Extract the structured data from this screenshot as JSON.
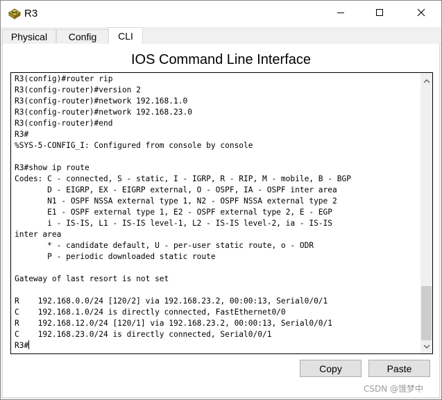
{
  "window": {
    "title": "R3"
  },
  "tabs": [
    {
      "label": "Physical",
      "active": false
    },
    {
      "label": "Config",
      "active": false
    },
    {
      "label": "CLI",
      "active": true
    }
  ],
  "cli": {
    "heading": "IOS Command Line Interface",
    "lines": [
      "R3(config)#router rip",
      "R3(config-router)#version 2",
      "R3(config-router)#network 192.168.1.0",
      "R3(config-router)#network 192.168.23.0",
      "R3(config-router)#end",
      "R3#",
      "%SYS-5-CONFIG_I: Configured from console by console",
      "",
      "R3#show ip route",
      "Codes: C - connected, S - static, I - IGRP, R - RIP, M - mobile, B - BGP",
      "       D - EIGRP, EX - EIGRP external, O - OSPF, IA - OSPF inter area",
      "       N1 - OSPF NSSA external type 1, N2 - OSPF NSSA external type 2",
      "       E1 - OSPF external type 1, E2 - OSPF external type 2, E - EGP",
      "       i - IS-IS, L1 - IS-IS level-1, L2 - IS-IS level-2, ia - IS-IS",
      "inter area",
      "       * - candidate default, U - per-user static route, o - ODR",
      "       P - periodic downloaded static route",
      "",
      "Gateway of last resort is not set",
      "",
      "R    192.168.0.0/24 [120/2] via 192.168.23.2, 00:00:13, Serial0/0/1",
      "C    192.168.1.0/24 is directly connected, FastEthernet0/0",
      "R    192.168.12.0/24 [120/1] via 192.168.23.2, 00:00:13, Serial0/0/1",
      "C    192.168.23.0/24 is directly connected, Serial0/0/1"
    ],
    "prompt": "R3#"
  },
  "buttons": {
    "copy": "Copy",
    "paste": "Paste"
  },
  "watermark": "CSDN @饿梦中",
  "icons": {
    "app": "packet-tracer-router-icon",
    "minimize": "minimize-icon",
    "maximize": "maximize-icon",
    "close": "close-icon",
    "scroll_up": "arrow-up-icon",
    "scroll_down": "arrow-down-icon"
  }
}
